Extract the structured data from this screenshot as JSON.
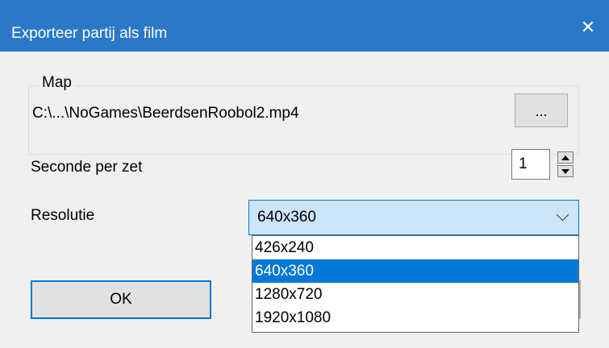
{
  "window": {
    "title": "Exporteer partij als film",
    "close_glyph": "✕"
  },
  "map_group": {
    "label": "Map",
    "path": "C:\\...\\NoGames\\BeerdsenRoobol2.mp4",
    "browse_label": "..."
  },
  "seconds": {
    "label": "Seconde per zet",
    "value": "1"
  },
  "resolution": {
    "label": "Resolutie",
    "selected": "640x360",
    "options": [
      "426x240",
      "640x360",
      "1280x720",
      "1920x1080"
    ]
  },
  "buttons": {
    "ok_label": "OK"
  },
  "colors": {
    "titlebar": "#2b78c9",
    "accent": "#0078d7",
    "selection_bg": "#cce4f7"
  }
}
